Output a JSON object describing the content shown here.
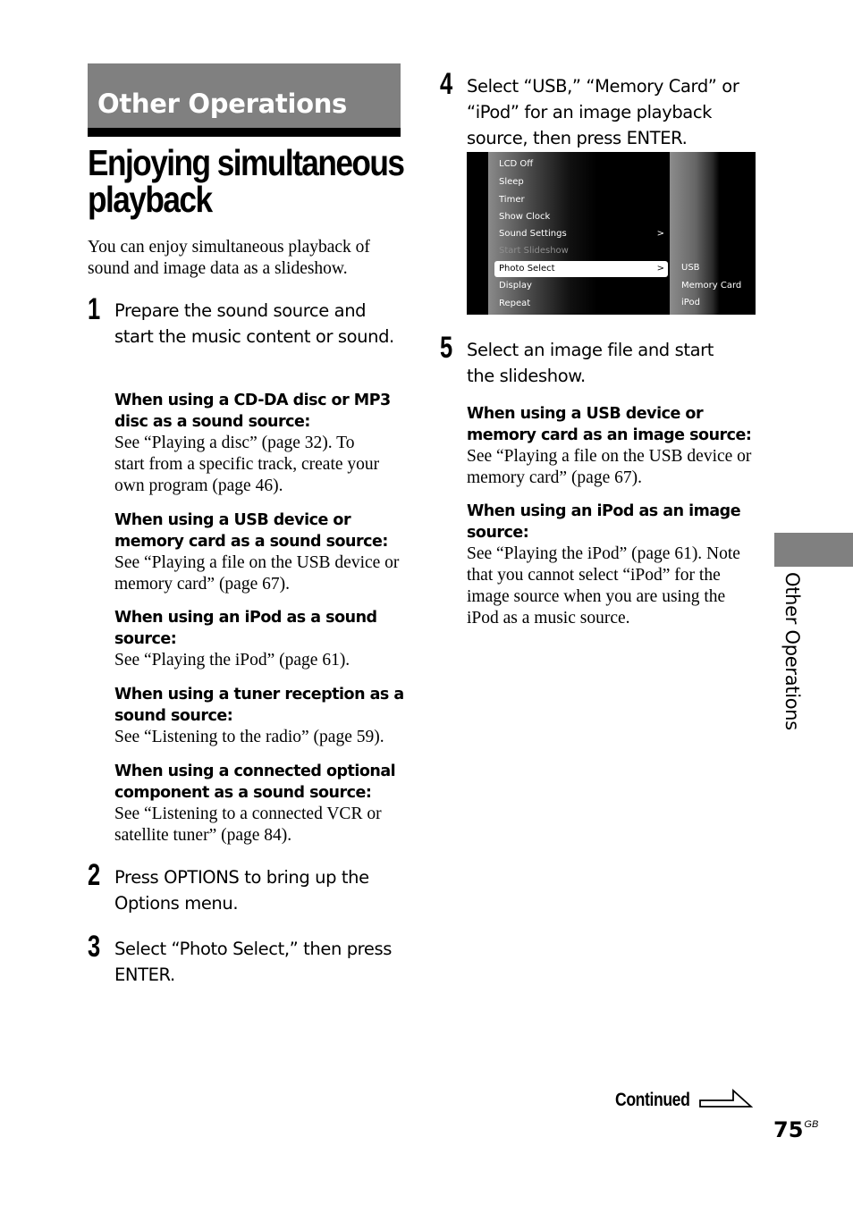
{
  "section": {
    "banner": "Other Operations",
    "side_tab": "Other Operations"
  },
  "title": "Enjoying simultaneous playback",
  "intro": "You can enjoy simultaneous playback of sound and image data as a slideshow.",
  "steps": [
    {
      "number": "1",
      "text": "Prepare the sound source and start the music content or sound.",
      "subsections": [
        {
          "heading": "When using a CD-DA disc or MP3 disc as a sound source:",
          "body": "See “Playing a disc” (page 32). To start from a specific track, create your own program (page 46)."
        },
        {
          "heading": "When using a USB device or memory card as a sound source:",
          "body": "See “Playing a file on the USB device or memory card” (page 67)."
        },
        {
          "heading": "When using an iPod as a sound source:",
          "body": "See “Playing the iPod” (page 61)."
        },
        {
          "heading": "When using a tuner reception as a sound source:",
          "body": "See “Listening to the radio” (page 59)."
        },
        {
          "heading": "When using a connected optional component as a sound source:",
          "body": "See “Listening to a connected VCR or satellite tuner” (page 84)."
        }
      ]
    },
    {
      "number": "2",
      "text": "Press OPTIONS to bring up the Options menu."
    },
    {
      "number": "3",
      "text": "Select “Photo Select,” then press ENTER."
    },
    {
      "number": "4",
      "text": "Select “USB,” “Memory Card” or “iPod” for an image playback source, then press ENTER."
    },
    {
      "number": "5",
      "text": "Select an image file and start the slideshow.",
      "subsections": [
        {
          "heading": "When using a USB device or memory card as an image source:",
          "body": "See “Playing a file on the USB device or memory card” (page 67)."
        },
        {
          "heading": "When using an iPod as an image source:",
          "body": "See “Playing the iPod” (page 61). Note that you cannot select “iPod” for the image source when you are using the iPod as a music source."
        }
      ]
    }
  ],
  "screen": {
    "menu": [
      {
        "label": "LCD Off",
        "state": "normal",
        "arrow": ""
      },
      {
        "label": "Sleep",
        "state": "normal",
        "arrow": ""
      },
      {
        "label": "Timer",
        "state": "normal",
        "arrow": ""
      },
      {
        "label": "Show Clock",
        "state": "normal",
        "arrow": ""
      },
      {
        "label": "Sound Settings",
        "state": "normal",
        "arrow": ">"
      },
      {
        "label": "Start Slideshow",
        "state": "disabled",
        "arrow": ""
      },
      {
        "label": "Photo Select",
        "state": "selected",
        "arrow": ">"
      },
      {
        "label": "Display",
        "state": "normal",
        "arrow": ""
      },
      {
        "label": "Repeat",
        "state": "normal",
        "arrow": ""
      }
    ],
    "submenu": [
      "USB",
      "Memory Card",
      "iPod"
    ]
  },
  "footer": {
    "continued": "Continued",
    "page_number": "75",
    "page_suffix": "GB"
  },
  "colors": {
    "banner_gray": "#808080",
    "text": "#000000",
    "screen_bg": "#000000",
    "disabled_item": "#8d8d8d"
  }
}
